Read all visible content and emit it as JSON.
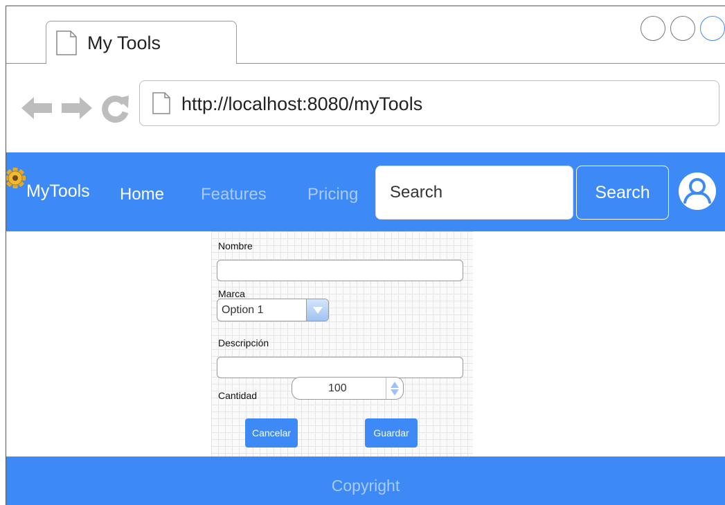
{
  "browser": {
    "tab_title": "My Tools",
    "url": "http://localhost:8080/myTools",
    "icons": [
      "back-arrow-icon",
      "forward-arrow-icon",
      "reload-icon",
      "document-icon"
    ]
  },
  "navbar": {
    "brand": "MyTools",
    "links": {
      "home": "Home",
      "features": "Features",
      "pricing": "Pricing"
    },
    "search_placeholder": "Search",
    "search_button": "Search",
    "colors": {
      "background": "#3d8af7",
      "inactive_link": "#a9cbfb"
    }
  },
  "form": {
    "nombre_label": "Nombre",
    "nombre_value": "",
    "marca_label": "Marca",
    "marca_selected": "Option 1",
    "descripcion_label": "Descripción",
    "descripcion_value": "",
    "cantidad_label": "Cantidad",
    "cantidad_value": "100",
    "cancel_button": "Cancelar",
    "save_button": "Guardar"
  },
  "footer": {
    "text": "Copyright"
  }
}
